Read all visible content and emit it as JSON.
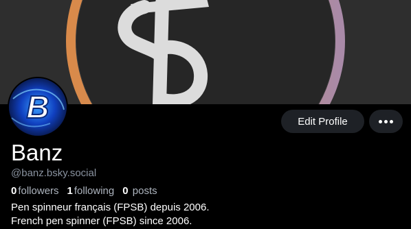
{
  "profile": {
    "display_name": "Banz",
    "handle": "@banz.bsky.social",
    "followers_count": "0",
    "followers_label": "followers",
    "following_count": "1",
    "following_label": "following",
    "posts_count": "0",
    "posts_label": "posts",
    "bio_lines": [
      "Pen spinneur français (FPSB) depuis 2006.",
      "French pen spinner (FPSB) since 2006."
    ]
  },
  "actions": {
    "edit_profile_label": "Edit Profile",
    "more_icon": "ellipsis-icon"
  },
  "colors": {
    "background": "#000000",
    "banner_bg": "#2e2e2e",
    "button_bg": "#1e2126",
    "ring_orange": "#d98a4a",
    "ring_purple": "#a98aa8",
    "muted_text": "#8a93a0"
  }
}
